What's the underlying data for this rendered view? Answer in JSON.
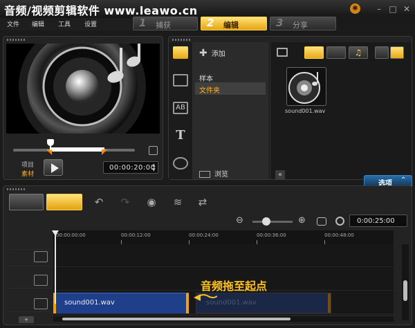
{
  "app": {
    "title": "音频/视频剪辑软件 www.leawo.cn",
    "logo_icon": "corel-logo-icon"
  },
  "window_controls": {
    "minimize": "–",
    "maximize": "□",
    "close": "✕"
  },
  "menu": {
    "items": [
      "文件",
      "编辑",
      "工具",
      "设置"
    ]
  },
  "steps": [
    {
      "num": "1",
      "label": "捕获",
      "active": false
    },
    {
      "num": "2",
      "label": "编辑",
      "active": true
    },
    {
      "num": "3",
      "label": "分享",
      "active": false
    }
  ],
  "player": {
    "mode_project": "项目",
    "mode_clip": "素材",
    "timecode": "00:00:20:00"
  },
  "library": {
    "add_label": "添加",
    "folders": [
      "样本",
      "文件夹"
    ],
    "selected_folder": "文件夹",
    "browse_label": "浏览",
    "thumb_label": "sound001.wav",
    "options_label": "选项"
  },
  "timeline": {
    "duration": "0:00:25:00",
    "ruler_ticks": [
      "00:00:00:00",
      "00:00:12:00",
      "00:00:24:00",
      "00:00:36:00",
      "00:00:48:00"
    ],
    "audio_clip_label": "sound001.wav",
    "ghost_clip_label": "sound001.wav",
    "annotation": "音频拖至起点"
  },
  "colors": {
    "accent": "#f0a20a",
    "selected": "#ffb21a",
    "clip": "#1f3f8a",
    "options": "#2a6da8"
  }
}
